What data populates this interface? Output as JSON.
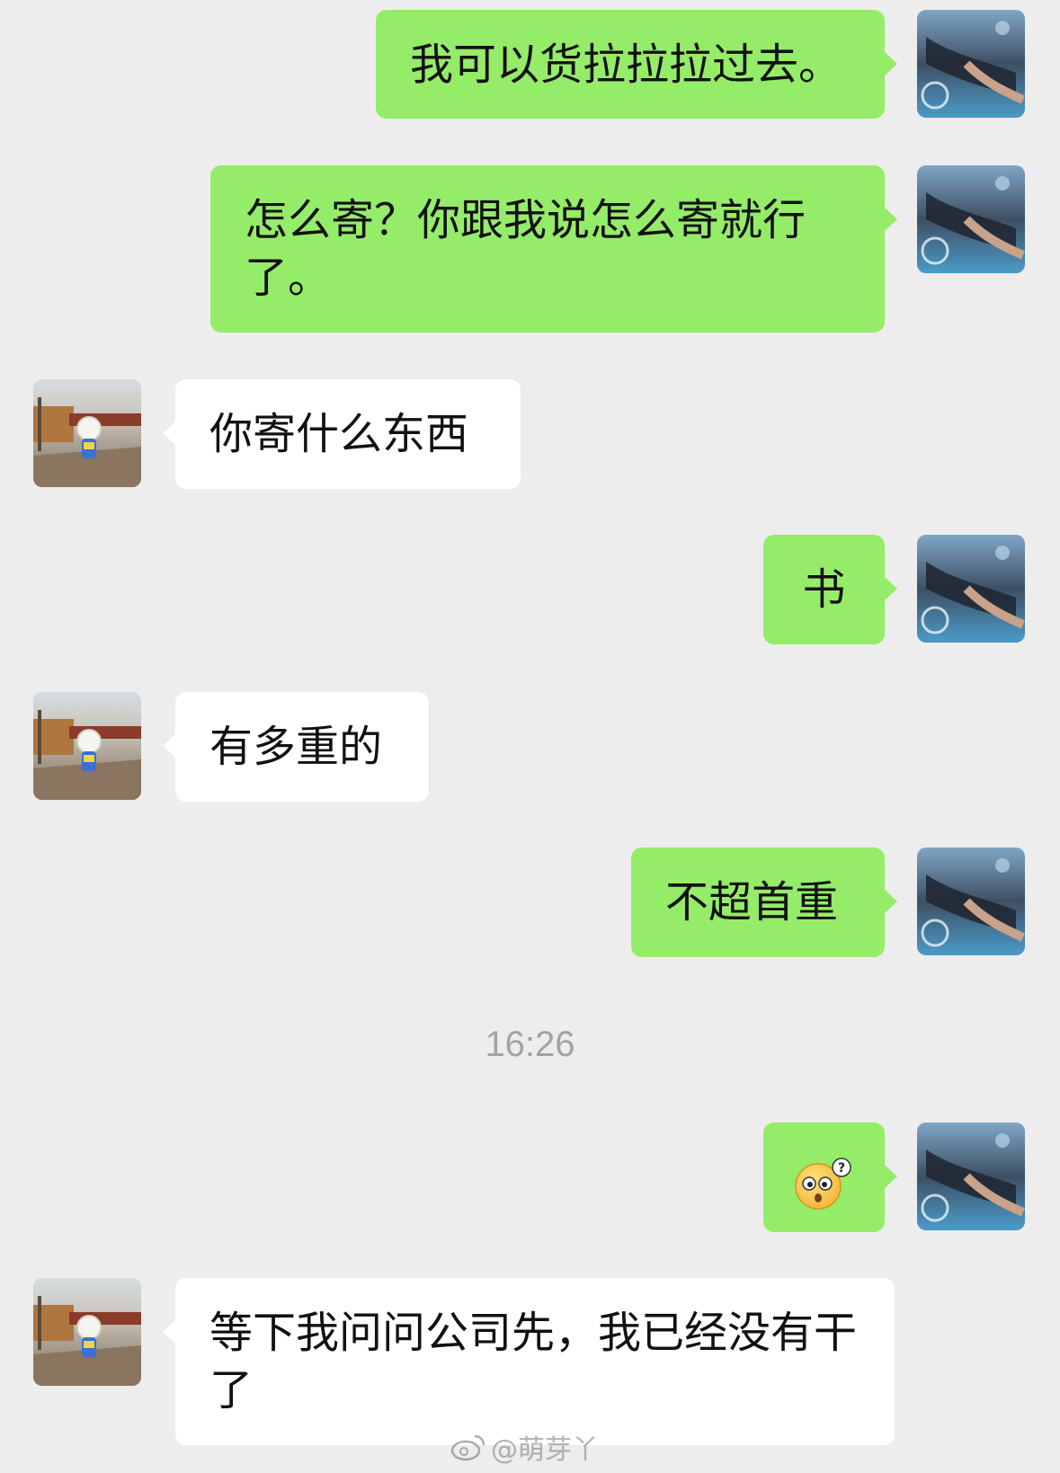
{
  "chat": {
    "timestamp": "16:26",
    "messages": [
      {
        "sender": "self",
        "text": "我可以货拉拉拉过去。"
      },
      {
        "sender": "self",
        "text": "怎么寄？你跟我说怎么寄就行了。"
      },
      {
        "sender": "other",
        "text": "你寄什么东西"
      },
      {
        "sender": "self",
        "text": "书"
      },
      {
        "sender": "other",
        "text": "有多重的"
      },
      {
        "sender": "self",
        "text": "不超首重"
      },
      {
        "sender": "self",
        "emoji": "confused-face-emoji"
      },
      {
        "sender": "other",
        "text": "等下我问问公司先，我已经没有干了"
      }
    ]
  },
  "watermark": {
    "text": "@萌芽丫"
  },
  "colors": {
    "background": "#ededed",
    "self_bubble": "#95ec69",
    "other_bubble": "#ffffff",
    "timestamp_text": "#a3a3a3"
  }
}
